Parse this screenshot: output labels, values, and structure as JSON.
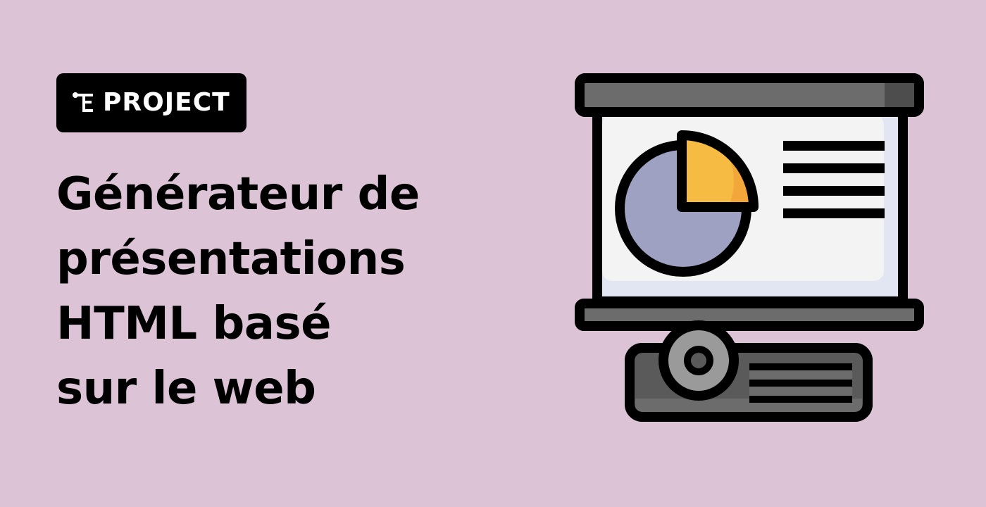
{
  "colors": {
    "background": "#dcc3d6",
    "badge_bg": "#000000",
    "badge_text": "#ffffff",
    "headline_text": "#000000",
    "outline": "#000000",
    "screen_bg": "#f3f3f3",
    "screen_shadow": "#e2e6f2",
    "bar_dark": "#6c6c6c",
    "bar_shade": "#4d4d4d",
    "pie_main": "#9ea1c1",
    "pie_shade": "#8587b3",
    "pie_slice": "#f6bb43",
    "pie_slice_shade": "#f3a73b",
    "projector_body": "#5a5a5a",
    "projector_light": "#6c6c6c",
    "lens_outer": "#9a9a9a",
    "lens_inner": "#5a5a5a"
  },
  "badge": {
    "icon": "labex-logo-icon",
    "label": "PROJECT"
  },
  "headline": {
    "lines": [
      "Générateur de",
      "présentations",
      "HTML basé",
      "sur le web"
    ]
  },
  "illustration": {
    "icon": "presentation-projector-icon",
    "chart_icon": "pie-chart-icon",
    "text_lines_count": 4
  }
}
